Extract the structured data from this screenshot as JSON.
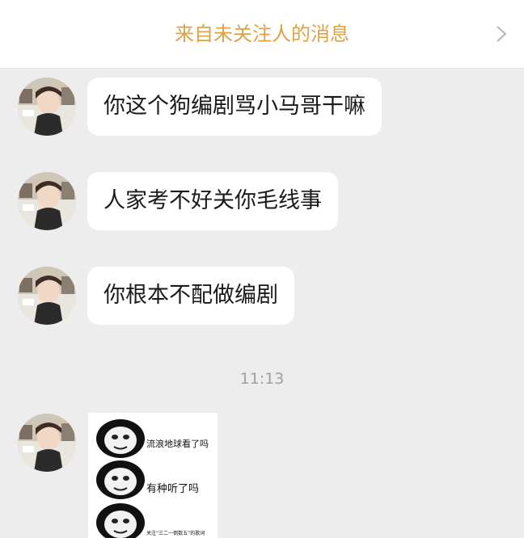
{
  "header": {
    "title": "来自未关注人的消息"
  },
  "messages": [
    {
      "text": "你这个狗编剧骂小马哥干嘛"
    },
    {
      "text": "人家考不好关你毛线事"
    },
    {
      "text": "你根本不配做编剧"
    }
  ],
  "timestamp": "11:13",
  "sticker": {
    "lines": [
      "流浪地球看了吗",
      "有种听了吗",
      "关注“三二一倒数五”的歌词"
    ]
  },
  "colors": {
    "header_title": "#e0a142",
    "chat_bg": "#ededed",
    "bubble_bg": "#ffffff"
  },
  "icons": [
    "chevron-right-icon",
    "avatar-photo",
    "panda-meme-face"
  ]
}
